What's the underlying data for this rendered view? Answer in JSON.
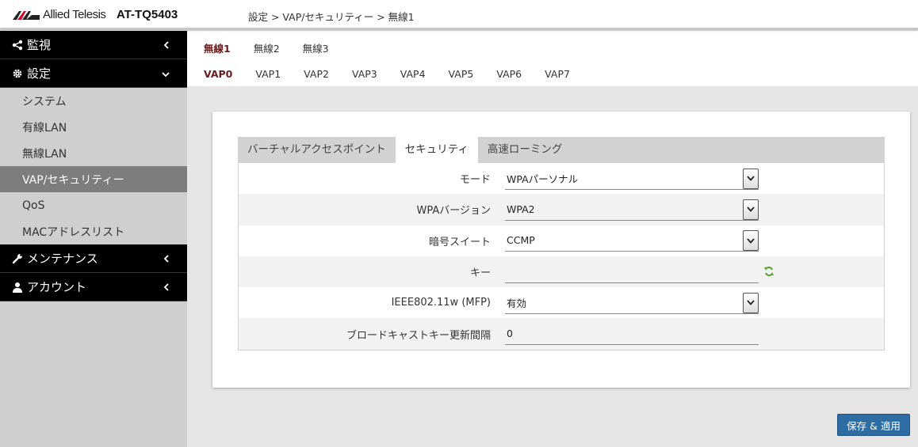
{
  "header": {
    "brand": "Allied Telesis",
    "model": "AT-TQ5403",
    "breadcrumb": "設定 > VAP/セキュリティー > 無線1"
  },
  "sidebar": {
    "sections": [
      {
        "label": "監視",
        "icon": "share-icon",
        "chevron": "‹"
      },
      {
        "label": "設定",
        "icon": "gear-icon",
        "chevron": "⌄"
      }
    ],
    "sub_items": [
      {
        "label": "システム"
      },
      {
        "label": "有線LAN"
      },
      {
        "label": "無線LAN"
      },
      {
        "label": "VAP/セキュリティー",
        "active": true
      },
      {
        "label": "QoS"
      },
      {
        "label": "MACアドレスリスト"
      }
    ],
    "bottom_sections": [
      {
        "label": "メンテナンス",
        "icon": "wrench-icon",
        "chevron": "‹"
      },
      {
        "label": "アカウント",
        "icon": "user-icon",
        "chevron": "‹"
      }
    ]
  },
  "radio_tabs": [
    "無線1",
    "無線2",
    "無線3"
  ],
  "vap_tabs": [
    "VAP0",
    "VAP1",
    "VAP2",
    "VAP3",
    "VAP4",
    "VAP5",
    "VAP6",
    "VAP7"
  ],
  "inner_tabs": [
    "バーチャルアクセスポイント",
    "セキュリティ",
    "高速ローミング"
  ],
  "form": {
    "rows": [
      {
        "label": "モード",
        "value": "WPAパーソナル",
        "type": "select"
      },
      {
        "label": "WPAバージョン",
        "value": "WPA2",
        "type": "select"
      },
      {
        "label": "暗号スイート",
        "value": "CCMP",
        "type": "select"
      },
      {
        "label": "キー",
        "value": "",
        "type": "password"
      },
      {
        "label": "IEEE802.11w (MFP)",
        "value": "有効",
        "type": "select"
      },
      {
        "label": "ブロードキャストキー更新間隔",
        "value": "0",
        "type": "text"
      }
    ]
  },
  "save_button": "保存 & 適用",
  "colors": {
    "active_tab": "#6b1b1b",
    "primary_button": "#2e6da4",
    "sidebar_active": "#7d7d7d",
    "refresh_icon": "#5aa02c"
  }
}
